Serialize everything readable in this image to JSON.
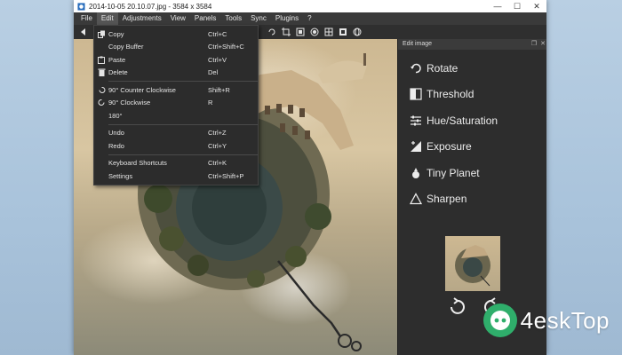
{
  "window": {
    "title": "2014-10-05 20.10.07.jpg  - 3584 x 3584",
    "controls": {
      "minimize": "—",
      "maximize": "☐",
      "close": "✕"
    }
  },
  "menubar": {
    "items": [
      "File",
      "Edit",
      "Adjustments",
      "View",
      "Panels",
      "Tools",
      "Sync",
      "Plugins",
      "?"
    ],
    "active_index": 1
  },
  "toolbar": {
    "icons": [
      "back-arrow-icon",
      "open-folder-icon",
      "rotate-icon",
      "crop-icon",
      "resize-icon",
      "filter-icon",
      "grid-icon",
      "frame-icon",
      "globe-icon"
    ]
  },
  "edit_menu": {
    "items": [
      {
        "icon": "copy-icon",
        "label": "Copy",
        "shortcut": "Ctrl+C"
      },
      {
        "icon": "",
        "label": "Copy Buffer",
        "shortcut": "Ctrl+Shift+C"
      },
      {
        "icon": "paste-icon",
        "label": "Paste",
        "shortcut": "Ctrl+V"
      },
      {
        "icon": "delete-icon",
        "label": "Delete",
        "shortcut": "Del"
      },
      {
        "icon": "rotate-ccw-icon",
        "label": "90° Counter Clockwise",
        "shortcut": "Shift+R"
      },
      {
        "icon": "rotate-cw-icon",
        "label": "90° Clockwise",
        "shortcut": "R"
      },
      {
        "icon": "",
        "label": "180°",
        "shortcut": ""
      },
      {
        "icon": "",
        "label": "Undo",
        "shortcut": "Ctrl+Z"
      },
      {
        "icon": "",
        "label": "Redo",
        "shortcut": "Ctrl+Y"
      },
      {
        "icon": "",
        "label": "Keyboard Shortcuts",
        "shortcut": "Ctrl+K"
      },
      {
        "icon": "",
        "label": "Settings",
        "shortcut": "Ctrl+Shift+P"
      }
    ]
  },
  "edit_panel": {
    "title": "Edit image",
    "header_buttons": [
      "❐",
      "✕"
    ],
    "tools": [
      {
        "icon": "rotate-icon",
        "label": "Rotate"
      },
      {
        "icon": "threshold-icon",
        "label": "Threshold"
      },
      {
        "icon": "sliders-icon",
        "label": "Hue/Saturation"
      },
      {
        "icon": "exposure-icon",
        "label": "Exposure"
      },
      {
        "icon": "tiny-planet-icon",
        "label": "Tiny Planet"
      },
      {
        "icon": "sharpen-icon",
        "label": "Sharpen"
      }
    ]
  },
  "watermark": {
    "text": "4eskTop"
  },
  "colors": {
    "panel_bg": "#2d2d2d",
    "menu_bg": "#2c2c2c",
    "text": "#ececec",
    "desktop": "#a9c3db"
  }
}
